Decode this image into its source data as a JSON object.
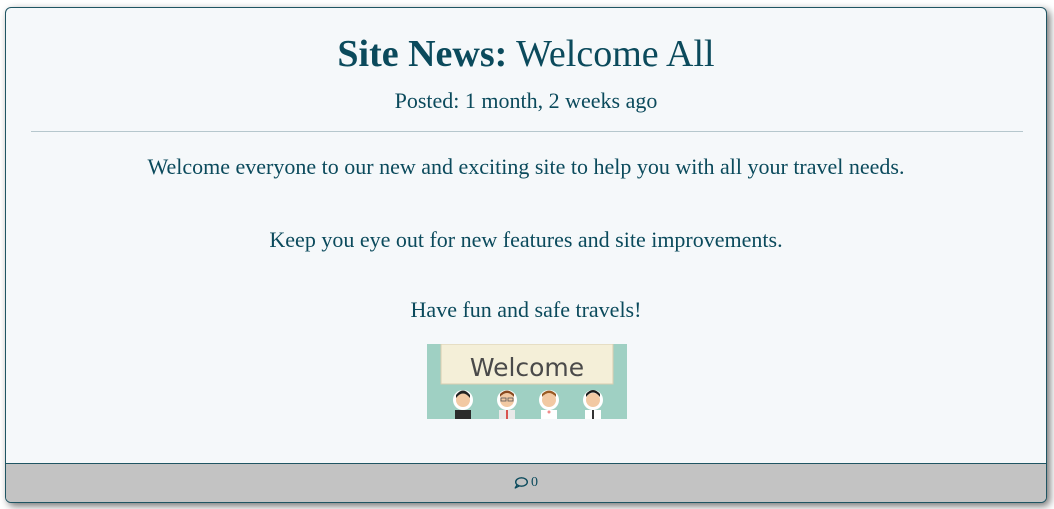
{
  "post": {
    "title_label": "Site News:",
    "title_text": "Welcome All",
    "posted": "Posted: 1 month, 2 weeks ago",
    "paragraphs": [
      "Welcome everyone to our new and exciting site to help you with all your travel needs.",
      "Keep you eye out for new features and site improvements.",
      "Have fun and safe travels!"
    ],
    "banner_text": "Welcome"
  },
  "footer": {
    "comment_icon": "comment-icon",
    "comment_count": "0"
  },
  "colors": {
    "text": "#0b4a5c",
    "card_bg": "#f5f8fa",
    "footer_bg": "#c3c3c3",
    "banner_bg": "#9fd0c3"
  }
}
